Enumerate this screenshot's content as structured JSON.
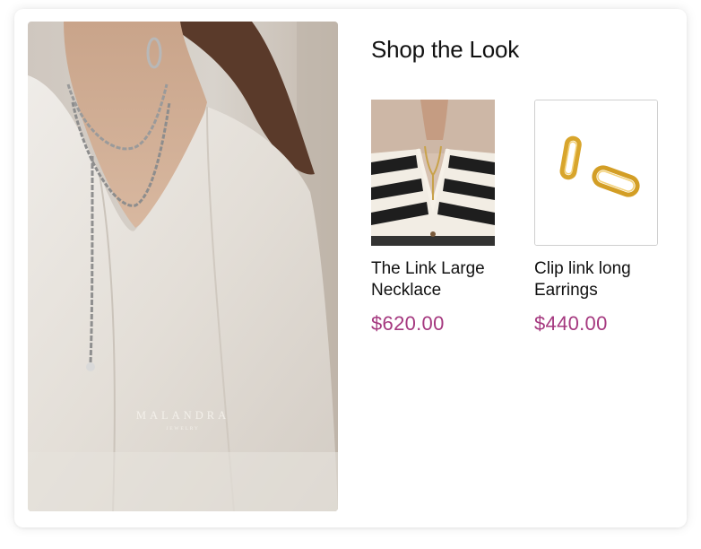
{
  "section": {
    "title": "Shop the Look"
  },
  "hero": {
    "brand_name": "MALANDRA",
    "brand_sub": "JEWELRY"
  },
  "products": [
    {
      "name": "The Link Large Necklace",
      "price": "$620.00",
      "image": "model-striped-cardigan-necklace"
    },
    {
      "name": "Clip link long Earrings",
      "price": "$440.00",
      "image": "gold-clip-link-earrings"
    }
  ],
  "colors": {
    "price": "#a5387f",
    "title": "#111111"
  }
}
